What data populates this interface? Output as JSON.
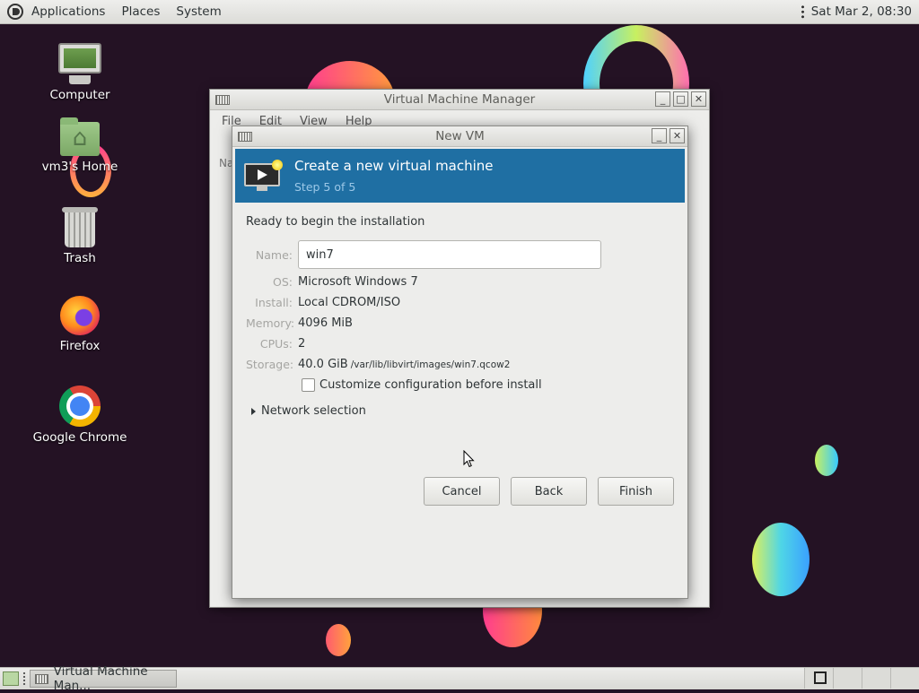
{
  "top_panel": {
    "menus": [
      "Applications",
      "Places",
      "System"
    ],
    "clock": "Sat Mar  2, 08:30"
  },
  "desktop_icons": [
    {
      "label": "Computer",
      "icon": "computer-icon"
    },
    {
      "label": "vm3's Home",
      "icon": "home-folder-icon"
    },
    {
      "label": "Trash",
      "icon": "trash-icon"
    },
    {
      "label": "Firefox",
      "icon": "firefox-icon"
    },
    {
      "label": "Google Chrome",
      "icon": "chrome-icon"
    }
  ],
  "vmm_window": {
    "title": "Virtual Machine Manager",
    "menus": [
      "File",
      "Edit",
      "View",
      "Help"
    ],
    "column_header": "Na"
  },
  "newvm_dialog": {
    "title": "New VM",
    "header_title": "Create a new virtual machine",
    "header_step": "Step 5 of 5",
    "ready_text": "Ready to begin the installation",
    "name_label": "Name:",
    "name_value": "win7",
    "os_label": "OS:",
    "os_value": "Microsoft Windows 7",
    "install_label": "Install:",
    "install_value": "Local CDROM/ISO",
    "memory_label": "Memory:",
    "memory_value": "4096 MiB",
    "cpus_label": "CPUs:",
    "cpus_value": "2",
    "storage_label": "Storage:",
    "storage_value": "40.0 GiB",
    "storage_path": "/var/lib/libvirt/images/win7.qcow2",
    "customize_label": "Customize configuration before install",
    "customize_checked": false,
    "network_label": "Network selection",
    "buttons": {
      "cancel": "Cancel",
      "back": "Back",
      "finish": "Finish"
    }
  },
  "taskbar": {
    "task_label": "Virtual Machine Man..."
  },
  "colors": {
    "banner": "#1f6fa3",
    "desktop": "#241224"
  }
}
